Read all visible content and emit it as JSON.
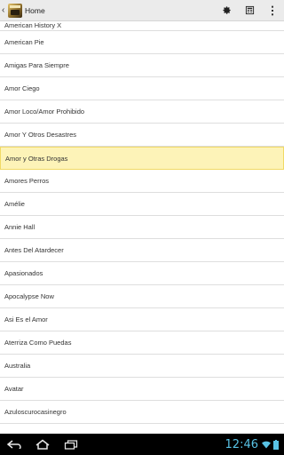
{
  "actionbar": {
    "title": "Home",
    "icons": [
      "settings-gear-icon",
      "view-toggle-icon",
      "overflow-menu-icon"
    ]
  },
  "list": {
    "items": [
      "American History X",
      "American Pie",
      "Amigas Para Siempre",
      "Amor Ciego",
      "Amor Loco/Amor Prohibido",
      "Amor Y Otros Desastres",
      "Amor y Otras Drogas",
      "Amores Perros",
      "Amélie",
      "Annie Hall",
      "Antes Del Atardecer",
      "Apasionados",
      "Apocalypse Now",
      "Asi Es el Amor",
      "Aterriza Como Puedas",
      "Australia",
      "Avatar",
      "Azuloscurocasinegro"
    ],
    "selected_index": 6,
    "colors": {
      "selected_bg": "#fdf3b8",
      "selected_border": "#f1d965",
      "divider": "#dedede"
    }
  },
  "navbar": {
    "clock": "12:46",
    "clock_color": "#59c3e6",
    "icons": [
      "back-icon",
      "home-icon",
      "recent-apps-icon",
      "wifi-icon",
      "battery-icon"
    ]
  }
}
